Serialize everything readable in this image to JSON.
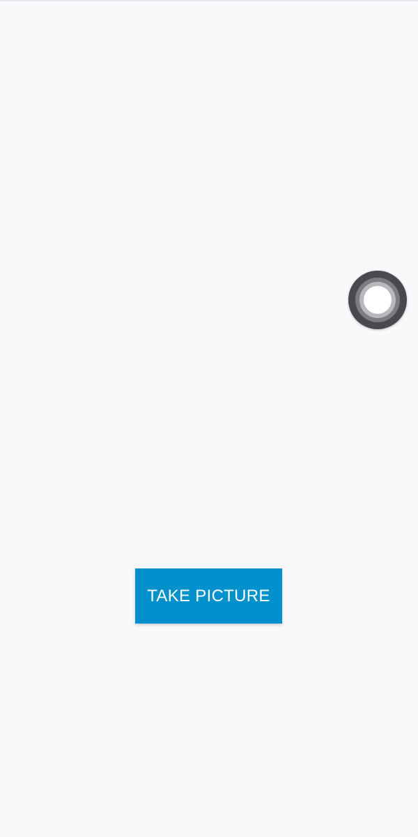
{
  "screen": {
    "background_color": "#f9f8fb"
  },
  "assistive_touch": {
    "icon": "assistive-touch-icon",
    "colors": {
      "outer": "#4a494d",
      "ring_2": "#7d7c80",
      "ring_3": "#b9b8bc",
      "core": "#ffffff"
    }
  },
  "actions": {
    "take_picture_label": "TAKE PICTURE",
    "take_picture_color": "#0291cd"
  }
}
